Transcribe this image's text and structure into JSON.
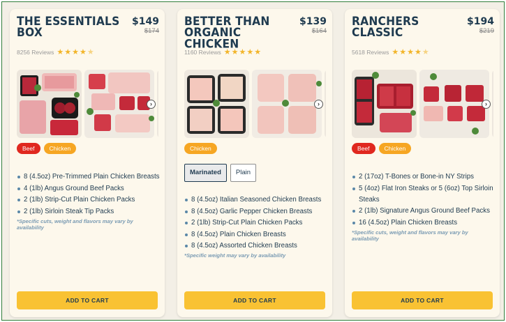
{
  "products": [
    {
      "title": "THE ESSENTIALS BOX",
      "price": "$149",
      "old_price": "$174",
      "reviews": "8256 Reviews",
      "rating": 4.5,
      "tags": [
        "Beef",
        "Chicken"
      ],
      "items": [
        "8 (4.5oz) Pre-Trimmed Plain Chicken Breasts",
        "4 (1lb) Angus Ground Beef Packs",
        "2 (1lb) Strip-Cut Plain Chicken Packs",
        "2 (1lb) Sirloin Steak Tip Packs"
      ],
      "disclaimer": "*Specific cuts, weight and flavors may vary by availability",
      "cart_label": "ADD TO CART"
    },
    {
      "title": "BETTER THAN ORGANIC CHICKEN",
      "price": "$139",
      "old_price": "$164",
      "reviews": "1160 Reviews",
      "rating": 5,
      "tags": [
        "Chicken"
      ],
      "options": [
        "Marinated",
        "Plain"
      ],
      "selected_option": "Marinated",
      "items": [
        "8 (4.5oz) Italian Seasoned Chicken Breasts",
        "8 (4.5oz) Garlic Pepper Chicken Breasts",
        "2 (1lb) Strip-Cut Plain Chicken Packs",
        "8 (4.5oz) Plain Chicken Breasts",
        "8 (4.5oz) Assorted Chicken Breasts"
      ],
      "disclaimer": "*Specific weight may vary by availability",
      "cart_label": "ADD TO CART"
    },
    {
      "title": "RANCHERS CLASSIC",
      "price": "$194",
      "old_price": "$219",
      "reviews": "5618 Reviews",
      "rating": 4.5,
      "tags": [
        "Beef",
        "Chicken"
      ],
      "items": [
        "2 (17oz) T-Bones or Bone-in NY Strips",
        "5 (4oz) Flat Iron Steaks or 5 (6oz) Top Sirloin Steaks",
        "2 (1lb) Signature Angus Ground Beef Packs",
        "16 (4.5oz) Plain Chicken Breasts"
      ],
      "disclaimer": "*Specific cuts, weight and flavors may vary by availability",
      "cart_label": "ADD TO CART"
    }
  ],
  "icons": {
    "star": "star-icon",
    "next": "chevron-right-icon"
  },
  "colors": {
    "title": "#1e3a4f",
    "star": "#f2b52a",
    "beef_tag": "#e0281f",
    "chicken_tag": "#f6a623",
    "cart_button": "#f9c233",
    "card_bg": "#fdf8ec"
  }
}
